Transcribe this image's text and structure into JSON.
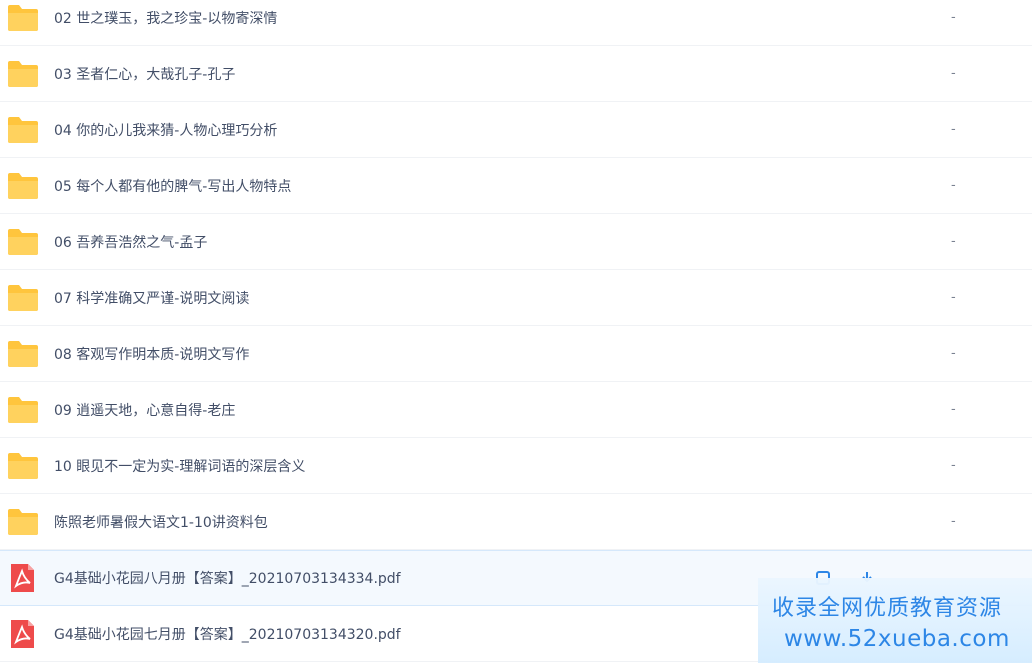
{
  "files": [
    {
      "name": "02 世之璞玉，我之珍宝-以物寄深情",
      "size": "-",
      "type": "folder"
    },
    {
      "name": "03 圣者仁心，大哉孔子-孔子",
      "size": "-",
      "type": "folder"
    },
    {
      "name": "04 你的心儿我来猜-人物心理巧分析",
      "size": "-",
      "type": "folder"
    },
    {
      "name": "05 每个人都有他的脾气-写出人物特点",
      "size": "-",
      "type": "folder"
    },
    {
      "name": "06 吾养吾浩然之气-孟子",
      "size": "-",
      "type": "folder"
    },
    {
      "name": "07 科学准确又严谨-说明文阅读",
      "size": "-",
      "type": "folder"
    },
    {
      "name": "08 客观写作明本质-说明文写作",
      "size": "-",
      "type": "folder"
    },
    {
      "name": "09 逍遥天地，心意自得-老庄",
      "size": "-",
      "type": "folder"
    },
    {
      "name": "10 眼见不一定为实-理解词语的深层含义",
      "size": "-",
      "type": "folder"
    },
    {
      "name": "陈照老师暑假大语文1-10讲资料包",
      "size": "-",
      "type": "folder"
    },
    {
      "name": "G4基础小花园八月册【答案】_20210703134334.pdf",
      "size": "",
      "type": "pdf"
    },
    {
      "name": "G4基础小花园七月册【答案】_20210703134320.pdf",
      "size": "",
      "type": "pdf"
    }
  ],
  "watermark": {
    "line1": "收录全网优质教育资源",
    "line2": "www.52xueba.com"
  },
  "colors": {
    "folder": "#ffc53d",
    "pdf": "#ee4b4b",
    "accent": "#2d86e6",
    "text": "#424e67"
  }
}
